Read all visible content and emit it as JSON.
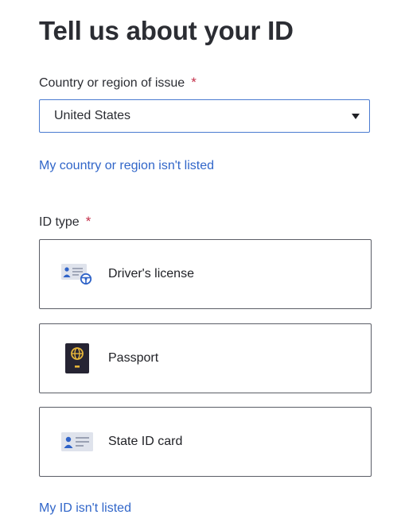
{
  "page": {
    "title": "Tell us about your ID"
  },
  "country_field": {
    "label": "Country or region of issue",
    "required_mark": "*",
    "selected_value": "United States",
    "not_listed_link": "My country or region isn't listed"
  },
  "id_type_field": {
    "label": "ID type",
    "required_mark": "*",
    "options": [
      {
        "label": "Driver's license",
        "icon": "drivers-license-icon"
      },
      {
        "label": "Passport",
        "icon": "passport-icon"
      },
      {
        "label": "State ID card",
        "icon": "state-id-card-icon"
      }
    ],
    "not_listed_link": "My ID isn't listed"
  },
  "colors": {
    "text": "#2b2d33",
    "link": "#3166c9",
    "required": "#c4314b",
    "select_border": "#4a7bd0",
    "card_border": "#5a5d66",
    "passport_cover": "#262433",
    "passport_emblem": "#e6b53a",
    "id_card_bg": "#dfe3ec",
    "id_card_person": "#2f63c8"
  }
}
